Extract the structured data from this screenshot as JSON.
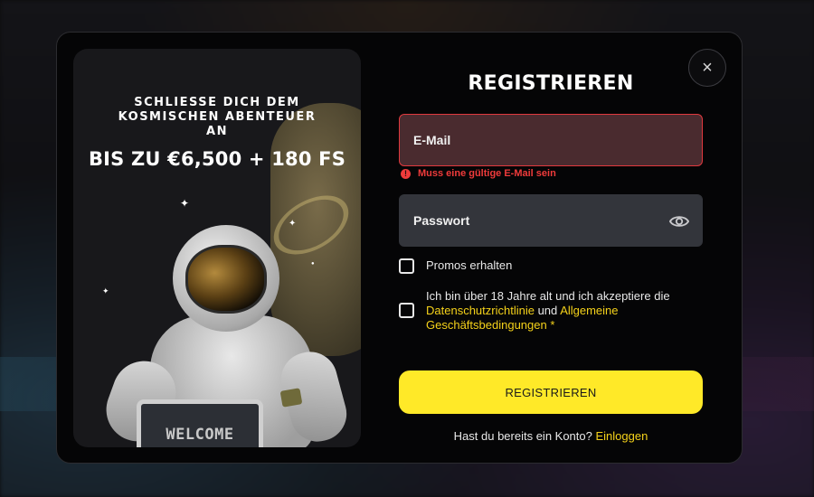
{
  "promo": {
    "subtitle": "SCHLIESSE DICH DEM KOSMISCHEN ABENTEUER AN",
    "headline": "BIS ZU €6,500 + 180 FS",
    "sign_text": "WELCOME",
    "patch_text": "BAW"
  },
  "modal": {
    "title": "REGISTRIEREN",
    "close_icon": "×"
  },
  "form": {
    "email": {
      "placeholder": "E-Mail",
      "value": "",
      "error": "Muss eine gültige E-Mail sein",
      "error_icon": "!"
    },
    "password": {
      "placeholder": "Passwort",
      "value": ""
    },
    "promos_label": "Promos erhalten",
    "terms": {
      "prefix": "Ich bin über 18 Jahre alt und ich akzeptiere die",
      "privacy_link": "Datenschutzrichtlinie",
      "and": "und",
      "terms_link": "Allgemeine Geschäftsbedingungen",
      "required_mark": "*"
    },
    "submit_label": "REGISTRIEREN",
    "login_prompt": "Hast du bereits ein Konto?",
    "login_link": "Einloggen"
  },
  "colors": {
    "accent": "#ffe928",
    "link": "#f5d21a",
    "error": "#ef3b3b"
  }
}
